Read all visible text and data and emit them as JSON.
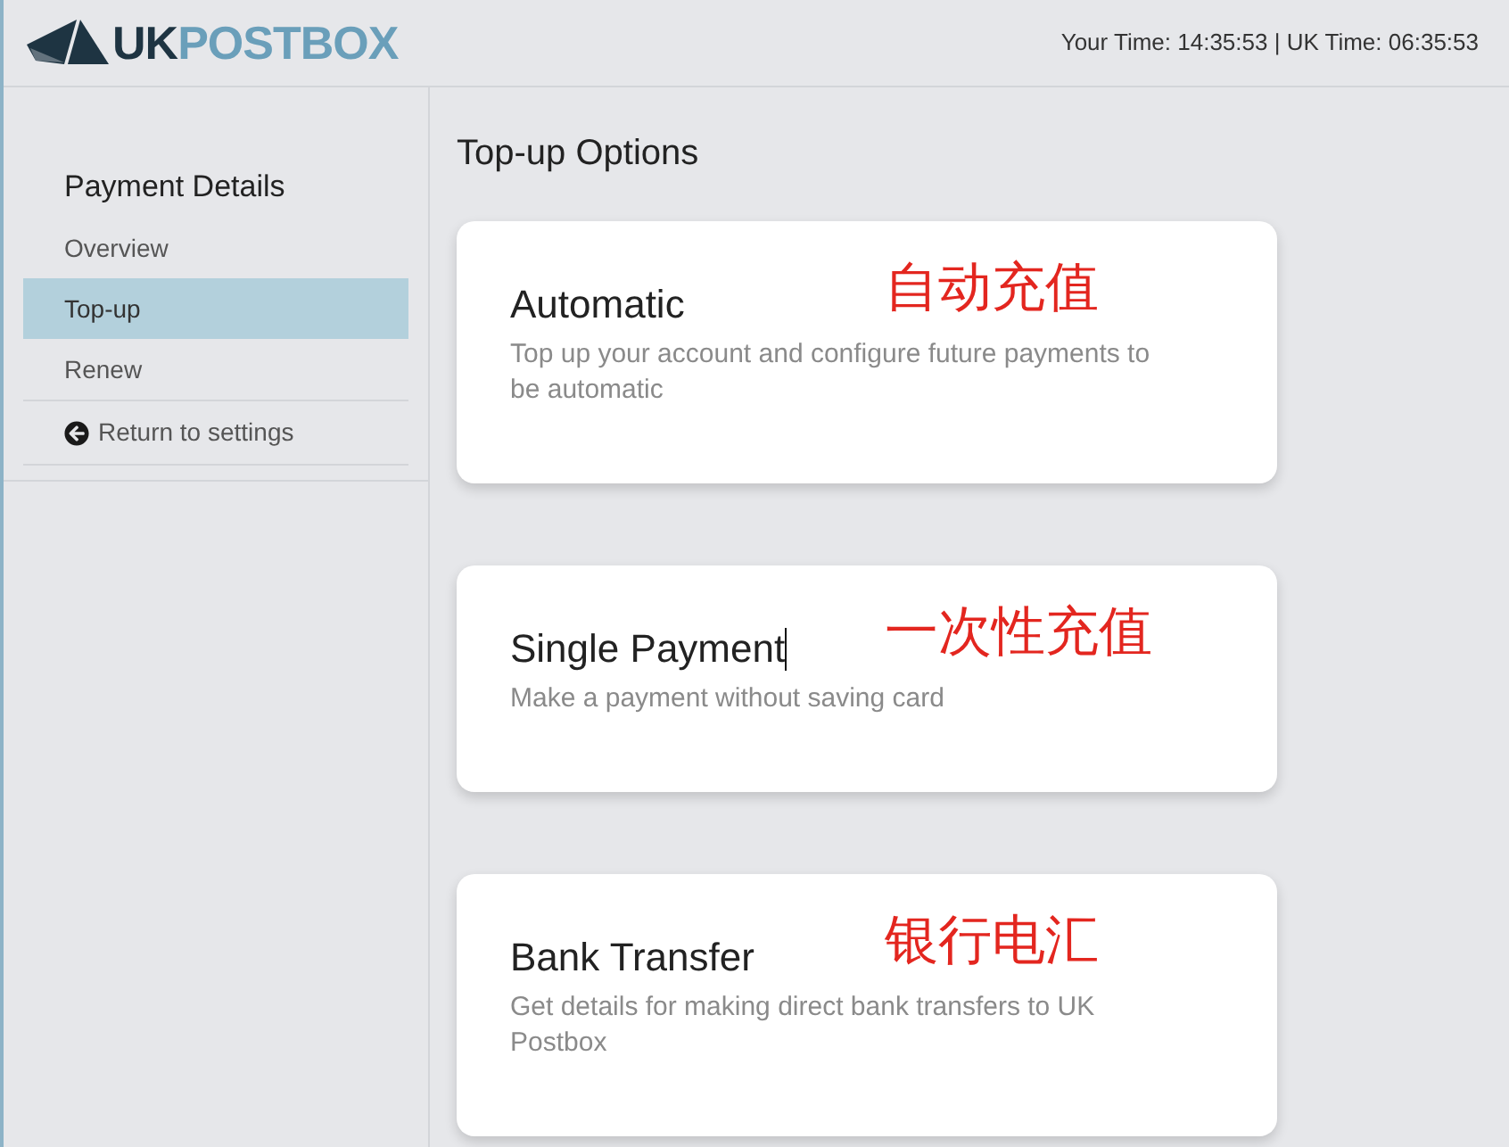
{
  "header": {
    "logo": {
      "prefix": "UK",
      "suffix": "POSTBOX"
    },
    "clock": "Your Time: 14:35:53 | UK Time: 06:35:53"
  },
  "sidebar": {
    "heading": "Payment Details",
    "items": [
      {
        "label": "Overview",
        "selected": false
      },
      {
        "label": "Top-up",
        "selected": true
      },
      {
        "label": "Renew",
        "selected": false
      }
    ],
    "back_link": "Return to settings"
  },
  "main": {
    "title": "Top-up Options",
    "options": [
      {
        "title": "Automatic",
        "description": "Top up your account and configure future payments to be automatic",
        "annotation": "自动充值",
        "text_cursor": false
      },
      {
        "title": "Single Payment",
        "description": "Make a payment without saving card",
        "annotation": "一次性充值",
        "text_cursor": true
      },
      {
        "title": "Bank Transfer",
        "description": "Get details for making direct bank transfers to UK Postbox",
        "annotation": "银行电汇",
        "text_cursor": false
      }
    ]
  }
}
